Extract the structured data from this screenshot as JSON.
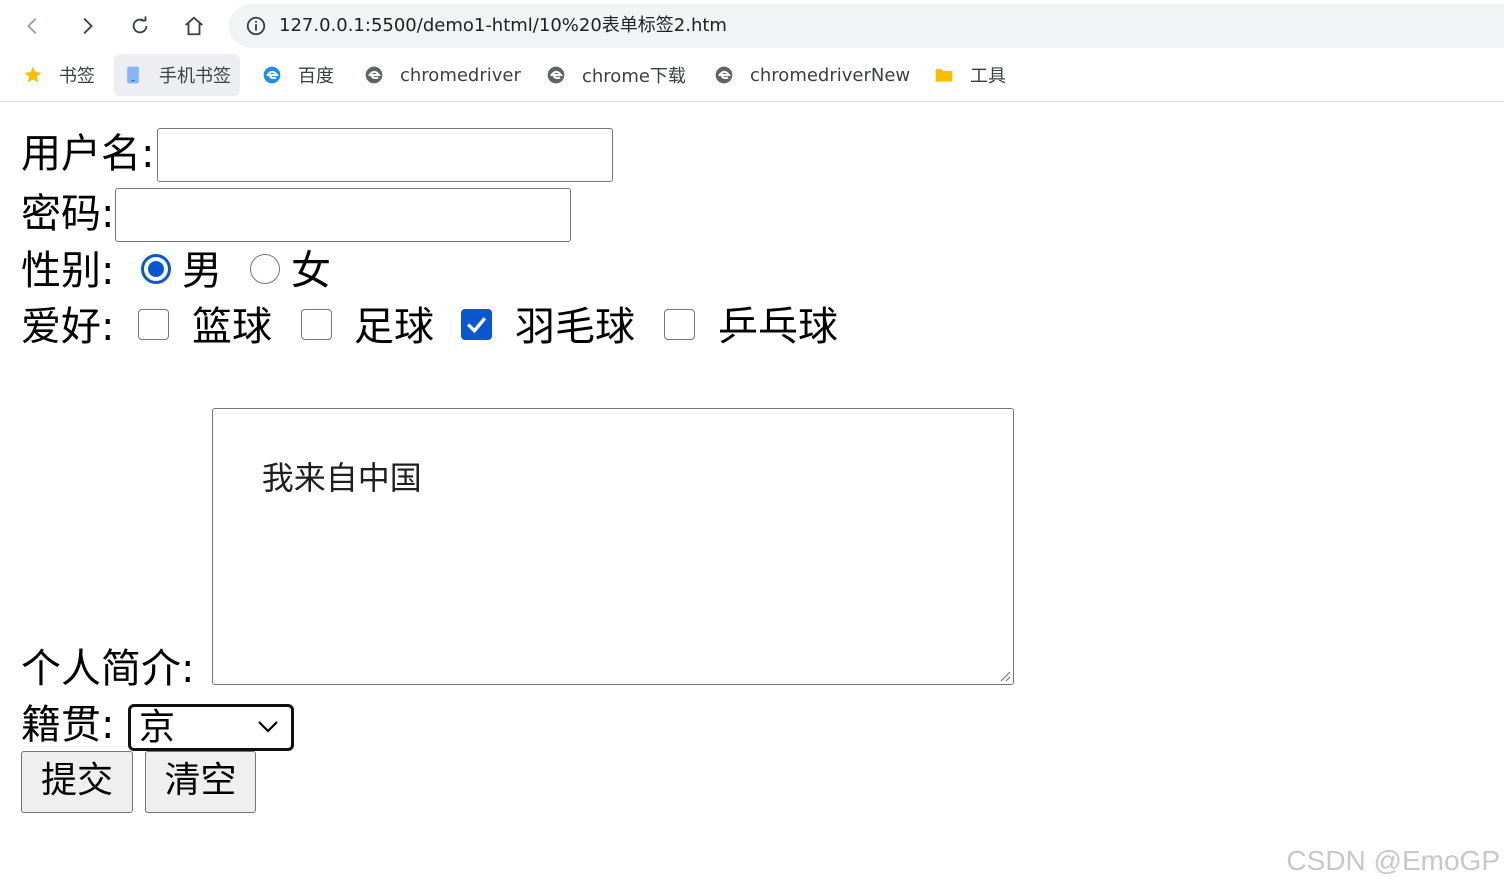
{
  "browser": {
    "url": "127.0.0.1:5500/demo1-html/10%20表单标签2.htm",
    "bookmarks": [
      {
        "label": "书签",
        "icon": "star-icon"
      },
      {
        "label": "手机书签",
        "icon": "mobile-bookmark-icon"
      },
      {
        "label": "百度",
        "icon": "edge-icon"
      },
      {
        "label": "chromedriver",
        "icon": "ie-icon"
      },
      {
        "label": "chrome下载",
        "icon": "ie-icon"
      },
      {
        "label": "chromedriverNew",
        "icon": "ie-icon"
      },
      {
        "label": "工具",
        "icon": "folder-icon"
      }
    ]
  },
  "form": {
    "username_label": "用户名:",
    "username_value": "",
    "password_label": "密码:",
    "password_value": "",
    "gender_label": "性别:",
    "gender_options": [
      "男",
      "女"
    ],
    "gender_selected": "男",
    "hobby_label": "爱好:",
    "hobbies": [
      {
        "label": "篮球",
        "checked": false
      },
      {
        "label": "足球",
        "checked": false
      },
      {
        "label": "羽毛球",
        "checked": true
      },
      {
        "label": "乒乓球",
        "checked": false
      }
    ],
    "intro_label": "个人简介:",
    "intro_value": "我来自中国",
    "origin_label": "籍贯:",
    "origin_selected": "京",
    "submit_label": "提交",
    "reset_label": "清空"
  },
  "watermark": "CSDN @EmoGP",
  "colors": {
    "accent": "#0b57d0",
    "omnibox_bg": "#f1f3f4"
  }
}
